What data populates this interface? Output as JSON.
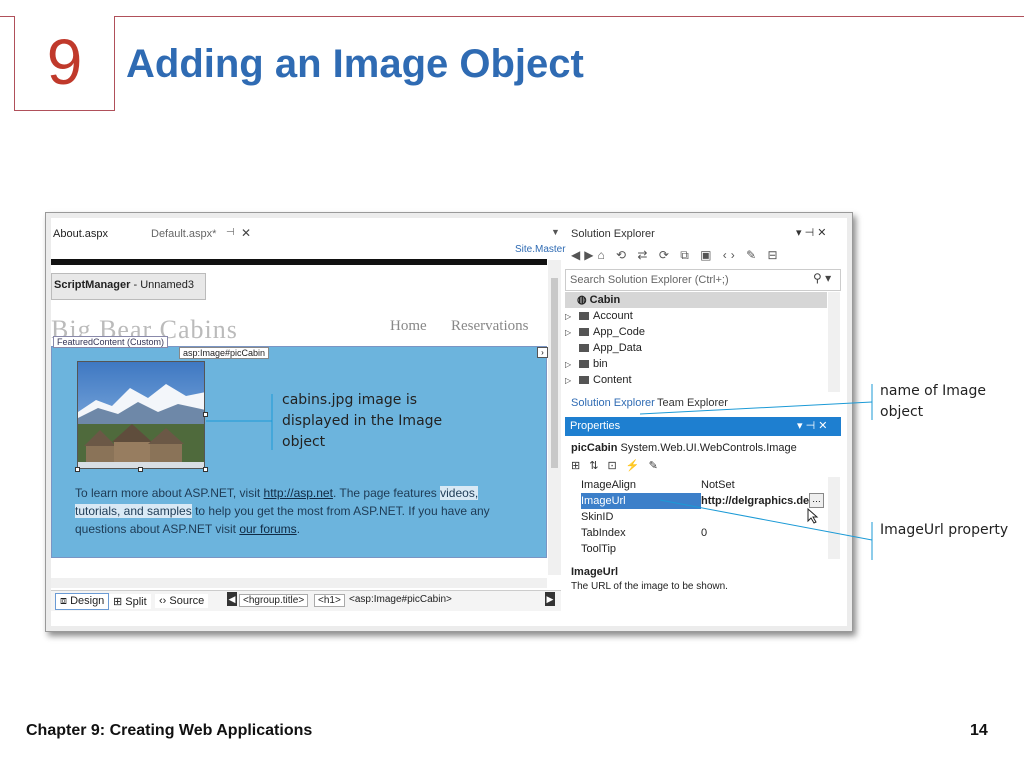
{
  "slide": {
    "chapter_number": "9",
    "title": "Adding an Image Object",
    "footer_left": "Chapter 9: Creating Web Applications",
    "page_number": "14"
  },
  "designer": {
    "tab_about": "About.aspx",
    "tab_default": "Default.aspx*",
    "tab_pin": "⊣",
    "tab_close": "✕",
    "master_label": "Site.Master",
    "scriptmanager_type": "ScriptManager",
    "scriptmanager_name": " - Unnamed3",
    "site_name": "Big Bear Cabins",
    "nav": [
      "Home",
      "Reservations"
    ],
    "featured_tag": "FeaturedContent (Custom)",
    "image_tag": "asp:Image#picCabin",
    "body_parts": [
      "To learn more about ASP.NET, visit ",
      "http://asp.net",
      ". The page features ",
      "videos, tutorials, and samples",
      " to help you get the most from ASP.NET. If you have any questions about ASP.NET visit ",
      "our forums",
      "."
    ],
    "view_buttons": [
      "Design",
      "Split",
      "Source"
    ],
    "breadcrumbs": [
      "<hgroup.title>",
      "<h1>",
      "<asp:Image#picCabin>"
    ]
  },
  "solution_explorer": {
    "title": "Solution Explorer",
    "search_placeholder": "Search Solution Explorer (Ctrl+;)",
    "tree": [
      {
        "label": "Cabin",
        "selected": true,
        "expander": ""
      },
      {
        "label": "Account",
        "expander": "▷"
      },
      {
        "label": "App_Code",
        "expander": "▷"
      },
      {
        "label": "App_Data",
        "expander": ""
      },
      {
        "label": "bin",
        "expander": "▷"
      },
      {
        "label": "Content",
        "expander": "▷"
      }
    ],
    "tabs": [
      "Solution Explorer",
      "Team Explorer"
    ]
  },
  "properties": {
    "title": "Properties",
    "object_name": "picCabin",
    "object_type": " System.Web.UI.WebControls.Image",
    "rows": [
      {
        "name": "ImageAlign",
        "value": "NotSet"
      },
      {
        "name": "ImageUrl",
        "value": "http://delgraphics.del"
      },
      {
        "name": "SkinID",
        "value": ""
      },
      {
        "name": "TabIndex",
        "value": "0"
      },
      {
        "name": "ToolTip",
        "value": ""
      }
    ],
    "desc_title": "ImageUrl",
    "desc_text": "The URL of the image to be shown."
  },
  "callouts": {
    "image_displayed": "cabins.jpg image is displayed in the Image object",
    "name_of_object": "name of Image object",
    "imageurl_property": "ImageUrl property"
  },
  "colors": {
    "title_blue": "#2f6bb3",
    "chapter_red": "#c0392b",
    "content_blue": "#6cb4dd",
    "properties_header": "#1e7fd0",
    "callout_line": "#1b9ad6"
  }
}
